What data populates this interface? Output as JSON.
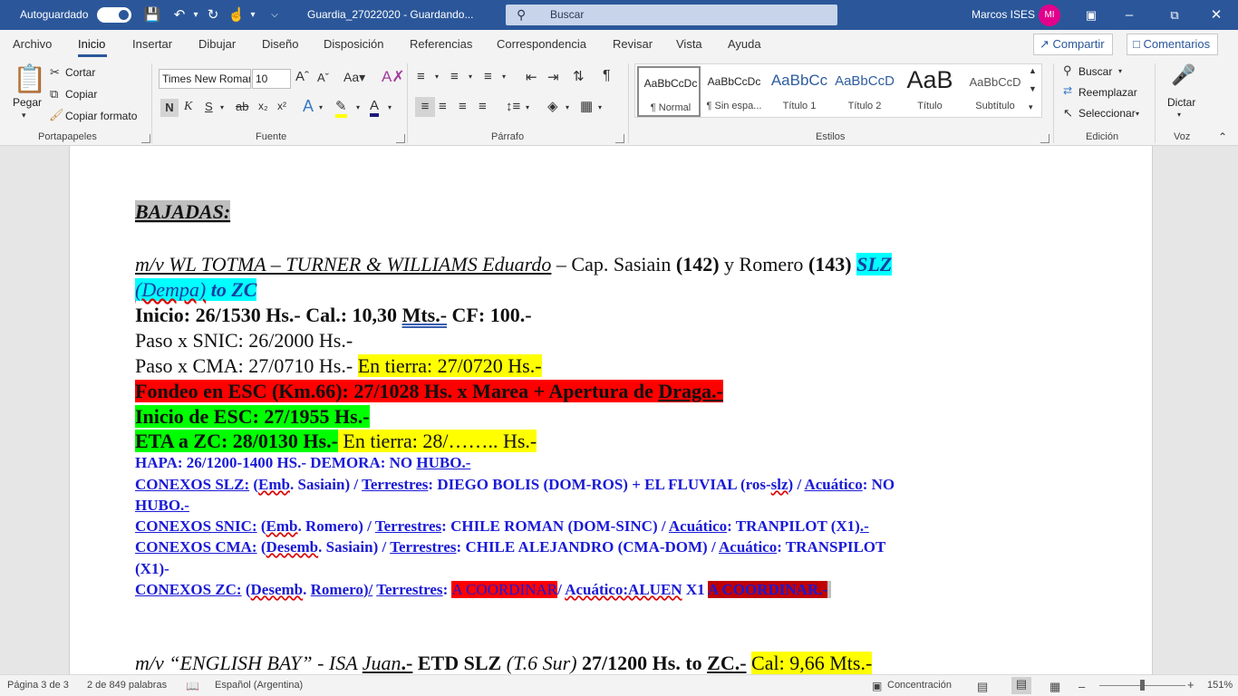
{
  "titlebar": {
    "autosave_label": "Autoguardado",
    "document_title": "Guardia_27022020 - Guardando...",
    "search_placeholder": "Buscar",
    "user_name": "Marcos ISES",
    "user_initials": "MI"
  },
  "menu_tabs": [
    "Archivo",
    "Inicio",
    "Insertar",
    "Dibujar",
    "Diseño",
    "Disposición",
    "Referencias",
    "Correspondencia",
    "Revisar",
    "Vista",
    "Ayuda"
  ],
  "header_buttons": {
    "share": "Compartir",
    "comments": "Comentarios"
  },
  "ribbon": {
    "clipboard": {
      "paste": "Pegar",
      "cut": "Cortar",
      "copy": "Copiar",
      "format_painter": "Copiar formato",
      "group": "Portapapeles"
    },
    "font": {
      "font_name": "Times New Roman",
      "font_size": "10",
      "group": "Fuente"
    },
    "paragraph": {
      "group": "Párrafo"
    },
    "styles": {
      "group": "Estilos",
      "items": [
        {
          "preview": "AaBbCcDc",
          "name": "¶ Normal"
        },
        {
          "preview": "AaBbCcDc",
          "name": "¶ Sin espa..."
        },
        {
          "preview": "AaBbCc",
          "name": "Título 1"
        },
        {
          "preview": "AaBbCcD",
          "name": "Título 2"
        },
        {
          "preview": "AaB",
          "name": "Título"
        },
        {
          "preview": "AaBbCcD",
          "name": "Subtítulo"
        }
      ]
    },
    "editing": {
      "find": "Buscar",
      "replace": "Reemplazar",
      "select": "Seleccionar",
      "group": "Edición"
    },
    "voice": {
      "dictate": "Dictar",
      "group": "Voz"
    }
  },
  "document": {
    "heading": "BAJADAS:",
    "vessel1": {
      "name_part": "m/v WL TOTMA – TURNER & WILLIAMS Eduardo",
      "dash": " – Cap. Sasiain ",
      "num1": "(142)",
      "and": " y Romero ",
      "num2": "(143)",
      "slz": "SLZ",
      "dempa": "(Dempa)",
      "to_zc": " to ZC",
      "inicio_a": "Inicio: 26/1530 Hs.- Cal.: 10,30 ",
      "inicio_mts": "Mts.-",
      "inicio_b": " CF: 100.-",
      "paso_snic": "Paso x SNIC: 26/2000 Hs.-",
      "paso_cma": "Paso x CMA: 27/0710 Hs.- ",
      "en_tierra1": "En tierra: 27/0720 Hs.-",
      "fondeo_a": "Fondeo en ESC (Km.66): 27/1028 Hs. x Marea + Apertura de ",
      "fondeo_draga": "Draga.-",
      "inicio_esc": "Inicio de ESC: 27/1955 Hs.-",
      "eta": "ETA a ZC: 28/0130 Hs.-",
      "en_tierra2": " En tierra: 28/…….. Hs.-",
      "hapa_a": "HAPA: 26/1200-1400 HS.- DEMORA: NO ",
      "hapa_b": "HUBO.-",
      "conexos_slz_lbl": "CONEXOS SLZ:",
      "conexos_slz_a": " (",
      "conexos_slz_emb": "Emb",
      "conexos_slz_b": ". Sasiain) / ",
      "terrestres": "Terrestres",
      "conexos_slz_c": ": DIEGO BOLIS (DOM-ROS) + EL FLUVIAL (ros-",
      "conexos_slz_slz": "slz",
      "conexos_slz_d": ") / ",
      "acuatico": "Acuático",
      "conexos_slz_e": ": NO",
      "conexos_slz_f": "HUBO.-",
      "conexos_snic_lbl": "CONEXOS SNIC:",
      "conexos_snic_a": " (",
      "conexos_snic_emb": "Emb",
      "conexos_snic_b": ". Romero) / ",
      "conexos_snic_c": ": CHILE ROMAN (DOM-SINC) / ",
      "conexos_snic_d": ": TRANPILOT (X1)",
      "conexos_snic_e": ".-",
      "conexos_cma_lbl": "CONEXOS CMA:",
      "conexos_cma_a": " (",
      "conexos_cma_desemb": "Desemb",
      "conexos_cma_b": ". Sasiain) / ",
      "conexos_cma_c": ": CHILE ALEJANDRO (CMA-DOM) / ",
      "conexos_cma_d": ": TRANSPILOT",
      "conexos_cma_e": "(X1)-",
      "conexos_zc_lbl": "CONEXOS ZC:",
      "conexos_zc_a": " (",
      "conexos_zc_desemb": "Desemb",
      "conexos_zc_b": ". ",
      "conexos_zc_romero": "Romero",
      "conexos_zc_c": ")/",
      "conexos_zc_d": ": ",
      "a_coordinar1": "A COORDINAR",
      "conexos_zc_e": "/ ",
      "acuatico_aluen": "Acuático:ALUEN",
      "conexos_zc_f": " X1 ",
      "a_coordinar2": "A COORDINAR.-"
    },
    "vessel2": {
      "name_a": "m/v “ENGLISH BAY” - ISA ",
      "name_juan": "Juan",
      "name_b": ".-",
      "etd": " ETD SLZ ",
      "t6": "(T.6 Sur)",
      "date": " 27/1200 Hs. to ",
      "zc": "ZC",
      "zc_end": ".-",
      "cal": "Cal: 9,66 Mts.-"
    }
  },
  "statusbar": {
    "page": "Página 3 de 3",
    "words": "2 de 849 palabras",
    "language": "Español (Argentina)",
    "focus": "Concentración",
    "zoom": "151%"
  }
}
